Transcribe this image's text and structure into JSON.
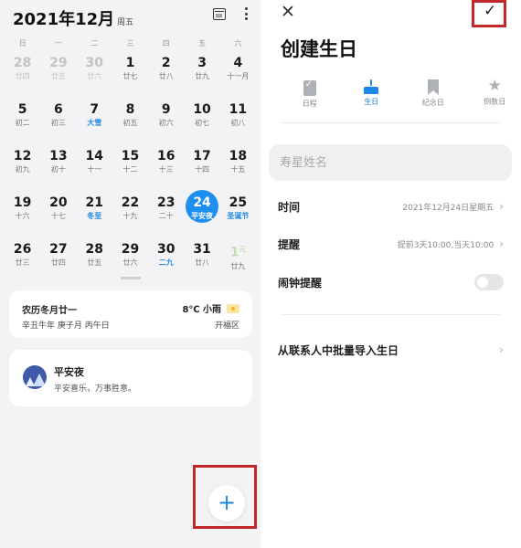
{
  "calendar": {
    "month_title": "2021年12月",
    "weekday_sub": "周五",
    "weekdays": [
      "日",
      "一",
      "二",
      "三",
      "四",
      "五",
      "六"
    ],
    "days": [
      {
        "d": "28",
        "l": "廿四",
        "dim": true
      },
      {
        "d": "29",
        "l": "廿五",
        "dim": true
      },
      {
        "d": "30",
        "l": "廿六",
        "dim": true
      },
      {
        "d": "1",
        "l": "廿七"
      },
      {
        "d": "2",
        "l": "廿八"
      },
      {
        "d": "3",
        "l": "廿九"
      },
      {
        "d": "4",
        "l": "十一月"
      },
      {
        "d": "5",
        "l": "初二"
      },
      {
        "d": "6",
        "l": "初三"
      },
      {
        "d": "7",
        "l": "大雪",
        "blue": true
      },
      {
        "d": "8",
        "l": "初五"
      },
      {
        "d": "9",
        "l": "初六"
      },
      {
        "d": "10",
        "l": "初七"
      },
      {
        "d": "11",
        "l": "初八"
      },
      {
        "d": "12",
        "l": "初九"
      },
      {
        "d": "13",
        "l": "初十"
      },
      {
        "d": "14",
        "l": "十一"
      },
      {
        "d": "15",
        "l": "十二"
      },
      {
        "d": "16",
        "l": "十三"
      },
      {
        "d": "17",
        "l": "十四"
      },
      {
        "d": "18",
        "l": "十五"
      },
      {
        "d": "19",
        "l": "十六"
      },
      {
        "d": "20",
        "l": "十七"
      },
      {
        "d": "21",
        "l": "冬至",
        "blue": true
      },
      {
        "d": "22",
        "l": "十九"
      },
      {
        "d": "23",
        "l": "二十"
      },
      {
        "d": "24",
        "l": "平安夜",
        "selected": true
      },
      {
        "d": "25",
        "l": "圣诞节",
        "blue": true
      },
      {
        "d": "26",
        "l": "廿三"
      },
      {
        "d": "27",
        "l": "廿四"
      },
      {
        "d": "28",
        "l": "廿五"
      },
      {
        "d": "29",
        "l": "廿六"
      },
      {
        "d": "30",
        "l": "二九",
        "blue": true
      },
      {
        "d": "31",
        "l": "廿八"
      },
      {
        "d": "1",
        "sup": "元",
        "l": "廿九",
        "jan": true
      }
    ],
    "selected_color": "#1e8ff0",
    "accent_color": "#1e88e5"
  },
  "lunar_card": {
    "lunar_date": "农历冬月廿一",
    "ganzhi": "辛丑牛年 庚子月 丙午日",
    "weather": "8℃ 小雨",
    "district": "开福区"
  },
  "event_card": {
    "title": "平安夜",
    "subtitle": "平安喜乐，万事胜意。"
  },
  "fab": {
    "icon": "plus-icon",
    "glyph": "+"
  },
  "form": {
    "close_glyph": "✕",
    "confirm_glyph": "✓",
    "title": "创建生日",
    "tabs": [
      {
        "label": "日程",
        "icon": "schedule-icon"
      },
      {
        "label": "生日",
        "icon": "birthday-cake-icon",
        "active": true
      },
      {
        "label": "纪念日",
        "icon": "bookmark-icon"
      },
      {
        "label": "倒数日",
        "icon": "star-icon"
      }
    ],
    "name_placeholder": "寿星姓名",
    "time_label": "时间",
    "time_value": "2021年12月24日星期五",
    "remind_label": "提醒",
    "remind_value": "提前3天10:00,当天10:00",
    "alarm_label": "闹钟提醒",
    "alarm_on": false,
    "import_label": "从联系人中批量导入生日",
    "chevron": "›"
  },
  "highlight_color": "#c0282b"
}
